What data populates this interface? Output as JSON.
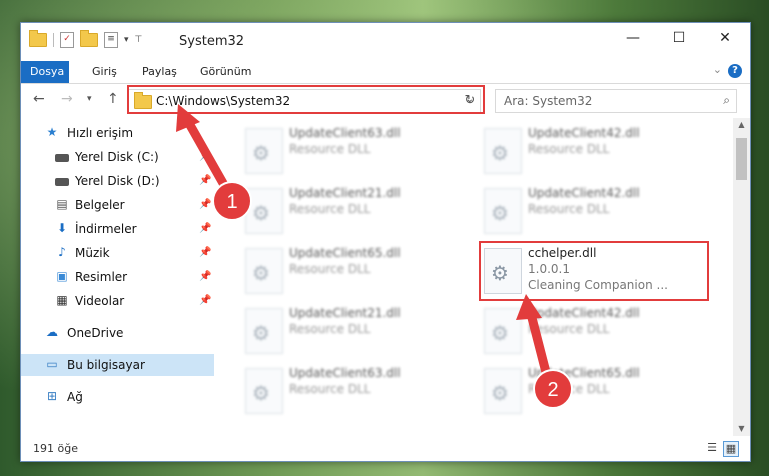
{
  "window": {
    "title": "System32",
    "minimize": "—",
    "maximize": "☐",
    "close": "✕"
  },
  "ribbon": {
    "tabs": [
      "Dosya",
      "Giriş",
      "Paylaş",
      "Görünüm"
    ],
    "help": "?",
    "expand": "⌄"
  },
  "address": {
    "path": "C:\\Windows\\System32",
    "search_placeholder": "Ara: System32"
  },
  "nav_pane": {
    "items": [
      {
        "label": "Hızlı erişim",
        "icon": "star-icon"
      },
      {
        "label": "Yerel Disk (C:)",
        "icon": "drive-icon",
        "pinned": true
      },
      {
        "label": "Yerel Disk (D:)",
        "icon": "drive-icon",
        "pinned": true
      },
      {
        "label": "Belgeler",
        "icon": "documents-icon",
        "pinned": true
      },
      {
        "label": "İndirmeler",
        "icon": "download-icon",
        "pinned": true
      },
      {
        "label": "Müzik",
        "icon": "music-icon",
        "pinned": true
      },
      {
        "label": "Resimler",
        "icon": "pictures-icon",
        "pinned": true
      },
      {
        "label": "Videolar",
        "icon": "video-icon",
        "pinned": true
      },
      {
        "label": "OneDrive",
        "icon": "cloud-icon"
      },
      {
        "label": "Bu bilgisayar",
        "icon": "computer-icon",
        "selected": true
      },
      {
        "label": "Ağ",
        "icon": "network-icon"
      }
    ]
  },
  "files": [
    {
      "name": "UpdateClient63.dll",
      "desc": "Resource DLL"
    },
    {
      "name": "UpdateClient42.dll",
      "desc": "Resource DLL"
    },
    {
      "name": "UpdateClient21.dll",
      "desc": "Resource DLL"
    },
    {
      "name": "UpdateClient42.dll",
      "desc": "Resource DLL"
    },
    {
      "name": "UpdateClient65.dll",
      "desc": "Resource DLL"
    },
    {
      "name": "cchelper.dll",
      "version": "1.0.0.1",
      "desc": "Cleaning Companion ..."
    },
    {
      "name": "UpdateClient21.dll",
      "desc": "Resource DLL"
    },
    {
      "name": "UpdateClient42.dll",
      "desc": "Resource DLL"
    },
    {
      "name": "UpdateClient63.dll",
      "desc": "Resource DLL"
    },
    {
      "name": "UpdateClient65.dll",
      "desc": "Resource DLL"
    }
  ],
  "status": {
    "item_count": "191 öğe"
  },
  "annotations": {
    "marker1": "1",
    "marker2": "2",
    "color": "#e23c3c"
  }
}
